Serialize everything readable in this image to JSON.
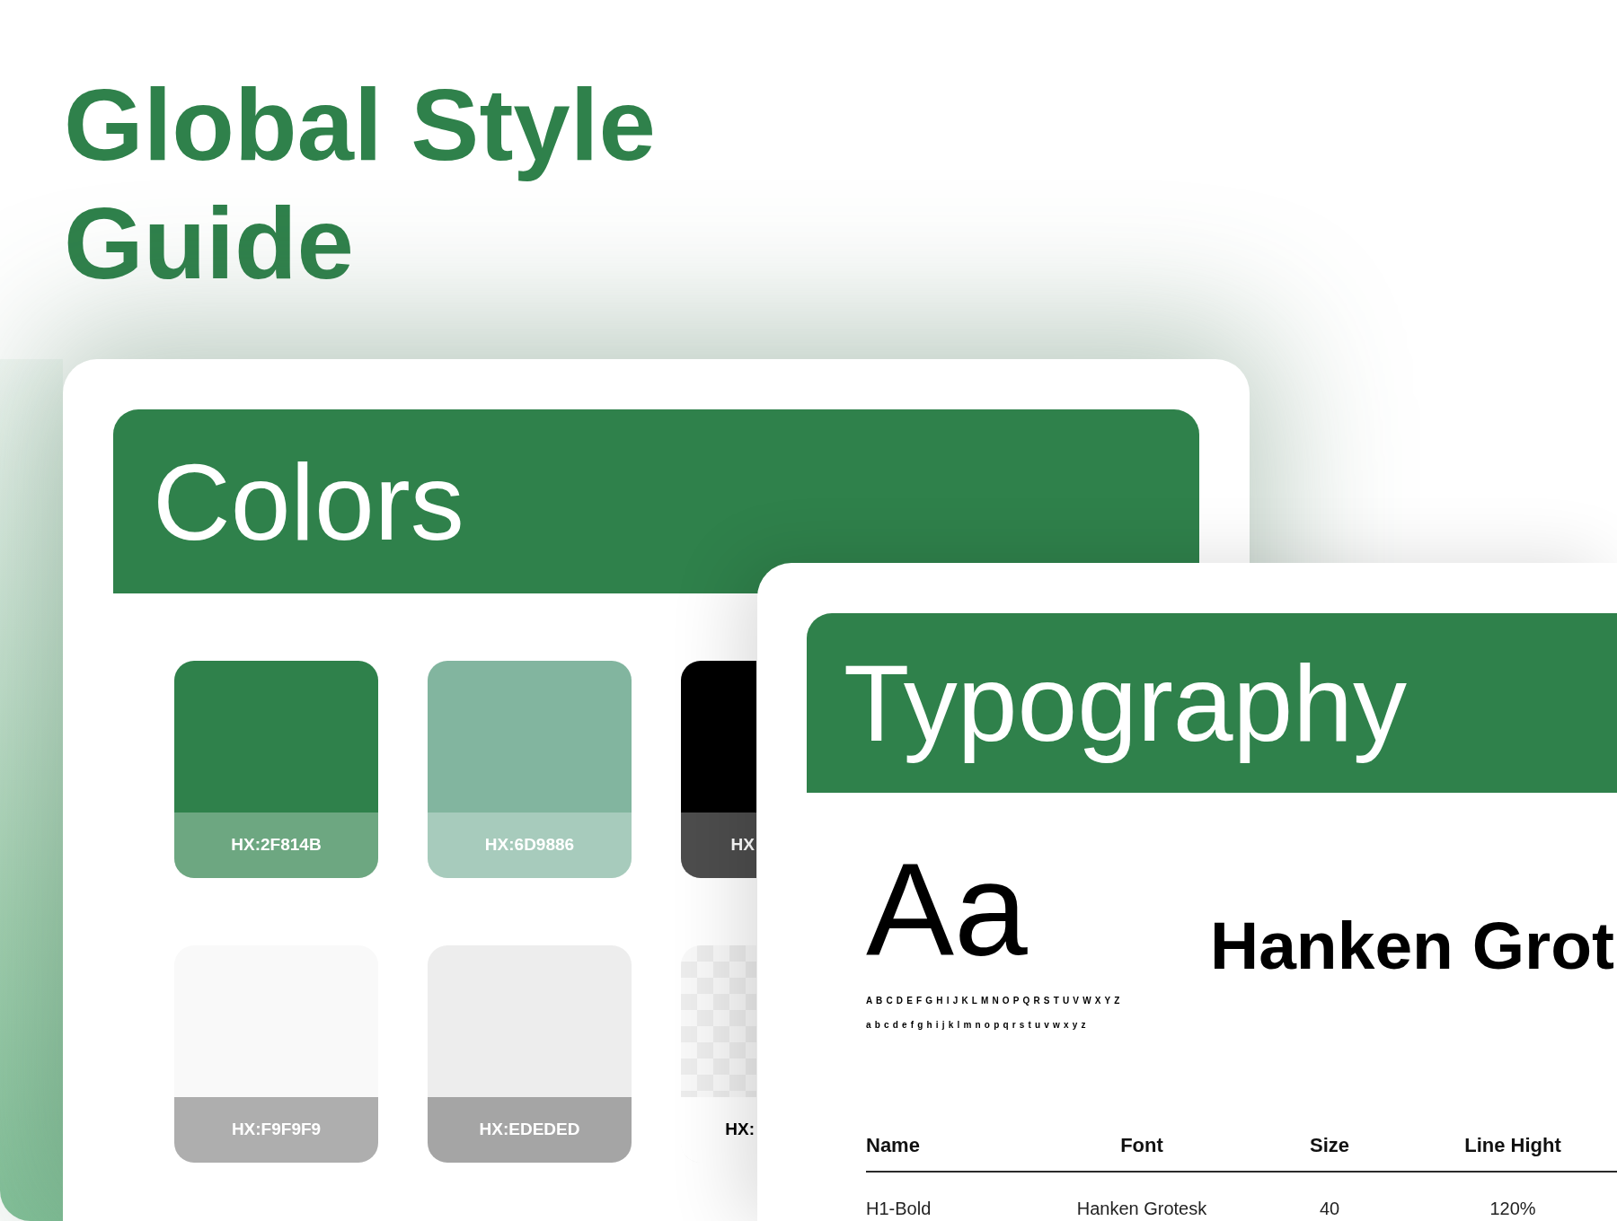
{
  "title": "Global Style Guide",
  "colors_card": {
    "heading": "Colors",
    "swatches": [
      {
        "label": "HX:2F814B",
        "color": "#2f814b",
        "kind": "dark"
      },
      {
        "label": "HX:6D9886",
        "color": "#82b59f",
        "kind": "dark"
      },
      {
        "label": "HX",
        "color": "#000000",
        "kind": "dark"
      },
      {
        "label": "HX:F9F9F9",
        "color": "#f9f9f9",
        "kind": "light"
      },
      {
        "label": "HX:EDEDED",
        "color": "#ededed",
        "kind": "light"
      },
      {
        "label": "HX:",
        "kind": "transparent"
      }
    ]
  },
  "typography_card": {
    "heading": "Typography",
    "specimen": "Aa",
    "uppercase": "A B C D E F G H I J K L M N O P Q R S T U V W X Y Z",
    "lowercase": "a b c d e f g h i j k l m n o p q r s t u v w x y z",
    "font_name": "Hanken Grot",
    "table": {
      "columns": [
        "Name",
        "Font",
        "Size",
        "Line Hight"
      ],
      "rows": [
        [
          "H1-Bold",
          "Hanken Grotesk",
          "40",
          "120%"
        ]
      ]
    }
  }
}
